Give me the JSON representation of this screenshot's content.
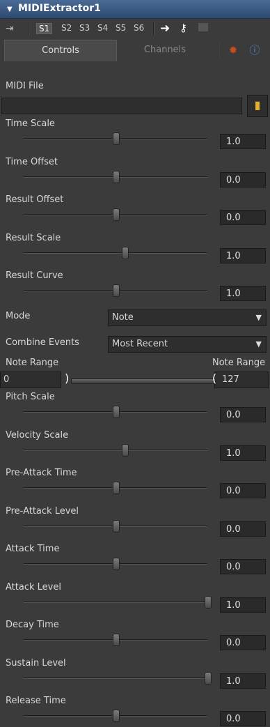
{
  "title": "MIDIExtractor1",
  "toolbar": {
    "slots": [
      "S1",
      "S2",
      "S3",
      "S4",
      "S5",
      "S6"
    ],
    "active_slot": "S1"
  },
  "tabs": {
    "controls": "Controls",
    "channels": "Channels"
  },
  "midi_file": {
    "label": "MIDI File",
    "value": ""
  },
  "sliders": [
    {
      "label": "Time Scale",
      "value": "1.0",
      "level": 0.5
    },
    {
      "label": "Time Offset",
      "value": "0.0",
      "level": 0.5
    },
    {
      "label": "Result Offset",
      "value": "0.0",
      "level": 0.5
    },
    {
      "label": "Result Scale",
      "value": "1.0",
      "level": 0.55
    },
    {
      "label": "Result Curve",
      "value": "1.0",
      "level": 0.5
    }
  ],
  "mode": {
    "label": "Mode",
    "value": "Note"
  },
  "combine": {
    "label": "Combine Events",
    "value": "Most Recent"
  },
  "note_range": {
    "label_low": "Note Range",
    "label_high": "Note Range",
    "low": "0",
    "high": "127"
  },
  "sliders2": [
    {
      "label": "Pitch Scale",
      "value": "0.0",
      "level": 0.5
    },
    {
      "label": "Velocity Scale",
      "value": "1.0",
      "level": 0.55
    },
    {
      "label": "Pre-Attack Time",
      "value": "0.0",
      "level": 0.5
    },
    {
      "label": "Pre-Attack Level",
      "value": "0.0",
      "level": 0.5
    },
    {
      "label": "Attack Time",
      "value": "0.0",
      "level": 0.5
    },
    {
      "label": "Attack Level",
      "value": "1.0",
      "level": 1.0
    },
    {
      "label": "Decay Time",
      "value": "0.0",
      "level": 0.5
    },
    {
      "label": "Sustain Level",
      "value": "1.0",
      "level": 1.0
    },
    {
      "label": "Release Time",
      "value": "0.0",
      "level": 0.5
    }
  ]
}
